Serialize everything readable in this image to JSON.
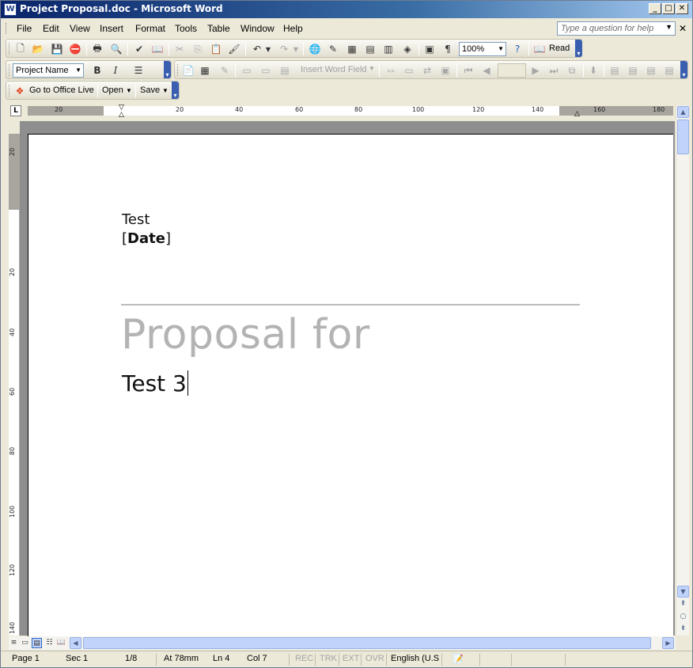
{
  "window": {
    "title": "Project Proposal.doc - Microsoft Word",
    "icon": "word-doc-icon"
  },
  "menubar": {
    "items": [
      "File",
      "Edit",
      "View",
      "Insert",
      "Format",
      "Tools",
      "Table",
      "Window",
      "Help"
    ],
    "help_placeholder": "Type a question for help"
  },
  "toolbar_standard": {
    "zoom": "100%",
    "read_label": "Read"
  },
  "toolbar_formatting": {
    "style_value": "Project Name",
    "insert_word_field": "Insert Word Field"
  },
  "toolbar_office_live": {
    "go_label": "Go to Office Live",
    "open_label": "Open",
    "save_label": "Save"
  },
  "ruler": {
    "h_labels": [
      "20",
      "20",
      "40",
      "60",
      "80",
      "100",
      "120",
      "140",
      "160",
      "180"
    ],
    "v_labels": [
      "20",
      "20",
      "40",
      "60",
      "80",
      "100",
      "120",
      "140"
    ]
  },
  "document": {
    "company": "Test",
    "date_open": "[",
    "date_field": "Date",
    "date_close": "]",
    "heading": "Proposal for",
    "client": "Test 3"
  },
  "statusbar": {
    "page": "Page  1",
    "sec": "Sec  1",
    "pages": "1/8",
    "at": "At  78mm",
    "ln": "Ln  4",
    "col": "Col  7",
    "rec": "REC",
    "trk": "TRK",
    "ext": "EXT",
    "ovr": "OVR",
    "language": "English (U.S"
  }
}
